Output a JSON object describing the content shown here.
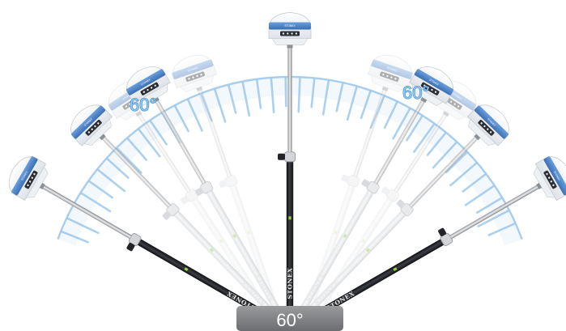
{
  "tilt_angle_left": "60°",
  "tilt_angle_right": "60°",
  "base_angle": "60°",
  "pole_brand": "STONEX",
  "receiver_brand": "STONEX",
  "colors": {
    "arc_stroke": "#9ec9ec",
    "arc_fill": "#e9f3fb",
    "receiver_band": "#4f86c9",
    "receiver_shell": "#f4f6f8",
    "pole_dark": "#1d1f22",
    "pole_light": "#dcdfe2",
    "base_plate": "#828385",
    "angle_label": "#8cc8ef"
  }
}
